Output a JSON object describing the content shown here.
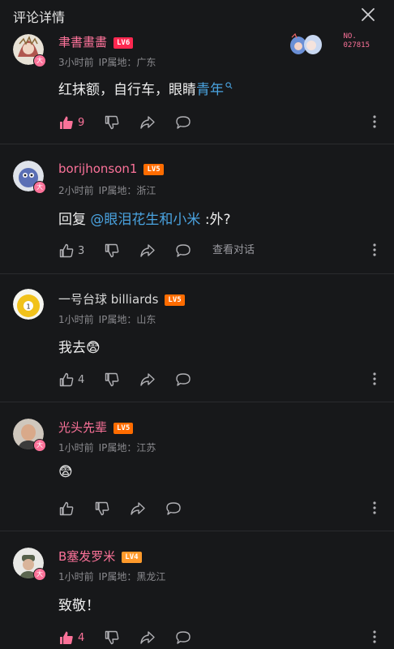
{
  "header": {
    "title": "评论详情"
  },
  "comments": [
    {
      "username": "聿書畫畵",
      "level": "LV6",
      "time": "3小时前",
      "ip": "IP属地：广东",
      "text_plain": "红抹额，自行车，眼睛",
      "text_link": "青年",
      "likes": "9",
      "badge_no": "NO.",
      "badge_num": "027815",
      "liked": true
    },
    {
      "username": "borijhonson1",
      "level": "LV5",
      "time": "2小时前",
      "ip": "IP属地：浙江",
      "reply_prefix": "回复",
      "mention": "@眼泪花生和小米",
      "text_rest": ":外?",
      "likes": "3",
      "view_thread": "查看对话"
    },
    {
      "username": "一号台球 billiards",
      "level": "LV5",
      "time": "1小时前",
      "ip": "IP属地：山东",
      "text": "我去😨",
      "likes": "4"
    },
    {
      "username": "光头先辈",
      "level": "LV5",
      "time": "1小时前",
      "ip": "IP属地：江苏",
      "text": "😨",
      "likes": ""
    },
    {
      "username": "B塞发罗米",
      "level": "LV4",
      "time": "1小时前",
      "ip": "IP属地：黑龙江",
      "text": "致敬！",
      "likes": "4",
      "liked": true
    }
  ],
  "avatar_badge": "大",
  "colors": {
    "accent": "#fb7299",
    "link": "#4aa3e0",
    "background": "#17181a"
  },
  "icons": [
    "close-icon",
    "thumbs-up-icon",
    "thumbs-down-icon",
    "share-icon",
    "reply-bubble-icon",
    "more-vertical-icon",
    "search-icon"
  ]
}
